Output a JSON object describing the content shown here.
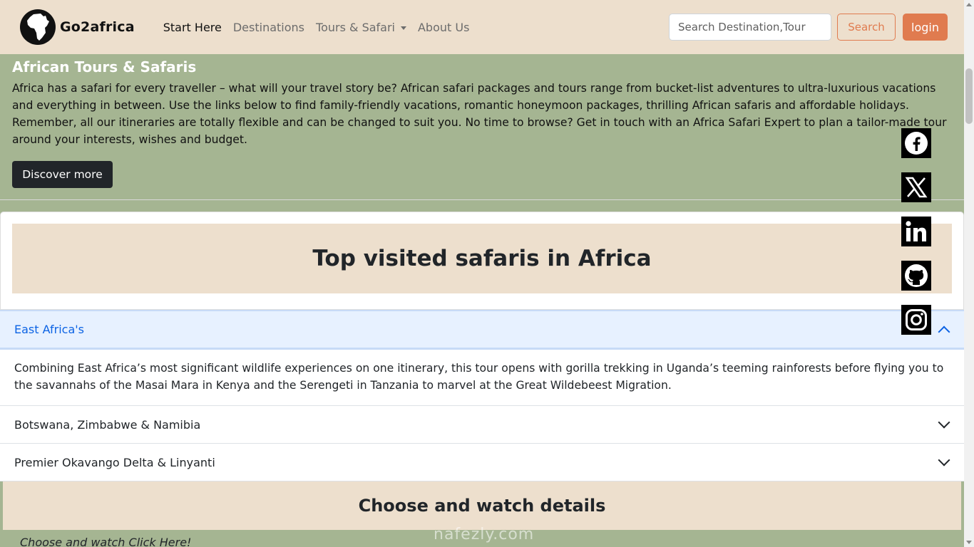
{
  "nav": {
    "logo_text": "Go2africa",
    "links": [
      {
        "label": "Start Here",
        "active": true
      },
      {
        "label": "Destinations",
        "active": false
      },
      {
        "label": "Tours & Safari",
        "active": false,
        "dropdown": true
      },
      {
        "label": "About Us",
        "active": false
      }
    ],
    "search_placeholder": "Search Destination,Tour",
    "search_label": "Search",
    "login_label": "login"
  },
  "hero": {
    "title": "African Tours & Safaris",
    "text": "Africa has a safari for every traveller – what will your travel story be? African safari packages and tours range from bucket-list adventures to ultra-luxurious vacations and everything in between. Use the links below to find family-friendly vacations, romantic honeymoon packages, thrilling African safaris and affordable holidays. Remember, all our itineraries are totally flexible and can be changed to suit you. No time to browse? Get in touch with an Africa Safari Expert to plan a tailor-made tour around your interests, wishes and budget.",
    "button_label": "Discover more"
  },
  "top_visited": {
    "title": "Top visited safaris in Africa"
  },
  "accordion": {
    "items": [
      {
        "title": "East Africa's",
        "open": true,
        "body": "Combining East Africa’s most significant wildlife experiences on one itinerary, this tour opens with gorilla trekking in Uganda’s teeming rainforests before flying you to the savannahs of the Masai Mara in Kenya and the Serengeti in Tanzania to marvel at the Great Wildebeest Migration."
      },
      {
        "title": "Botswana, Zimbabwe & Namibia",
        "open": false
      },
      {
        "title": "Premier Okavango Delta & Linyanti",
        "open": false
      }
    ]
  },
  "choose": {
    "title": "Choose and watch details",
    "subtitle": "Choose and watch Click Here!"
  },
  "watermark": "nafezly.com",
  "social": [
    "facebook-icon",
    "x-icon",
    "linkedin-icon",
    "github-icon",
    "instagram-icon"
  ],
  "colors": {
    "accent": "#e07b4f",
    "beige": "#eddfcd",
    "sage": "#a5b592",
    "accordion_active": "#e7f1ff"
  }
}
